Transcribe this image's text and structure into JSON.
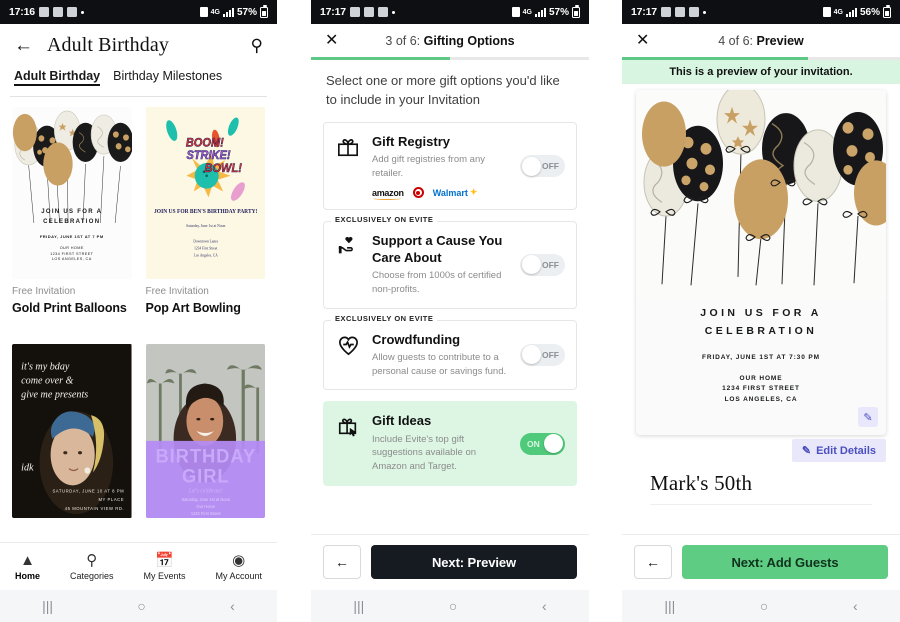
{
  "screen1": {
    "status": {
      "time": "17:16",
      "battery": "57%",
      "network": "4G"
    },
    "header": {
      "title": "Adult Birthday",
      "back_icon": "arrow-left-icon",
      "search_icon": "search-icon"
    },
    "tabs": [
      {
        "label": "Adult Birthday",
        "active": true
      },
      {
        "label": "Birthday Milestones",
        "active": false
      }
    ],
    "cards": [
      {
        "badge": "Free Invitation",
        "name": "Gold Print Balloons",
        "art": "balloons",
        "invite_heading": "JOIN US FOR A\nCELEBRATION",
        "invite_date": "FRIDAY, JUNE 1ST AT 7 PM",
        "invite_address": "OUR HOME\n1234 FIRST STREET\nLOS ANGELES, CA"
      },
      {
        "badge": "Free Invitation",
        "name": "Pop Art Bowling",
        "art": "bowling",
        "word1": "BOOM!",
        "word2": "STRIKE!",
        "word3": "BOWL!",
        "invite_heading": "JOIN US FOR BEN'S BIRTHDAY PARTY!",
        "invite_date": "Saturday, June 1st at Noon",
        "invite_address": "Downtown Lanes\n1234 First Street\nLos Angeles, CA"
      },
      {
        "art": "bday-portrait",
        "line1": "it's my bday",
        "line2": "come over &",
        "line3": "give me presents",
        "line4": "idk",
        "foot1": "SATURDAY, JUNE 10 AT 8 PM",
        "foot2": "MY PLACE",
        "foot3": "45 MOUNTAIN VIEW RD."
      },
      {
        "art": "birthday-girl",
        "title1": "BIRTHDAY",
        "title2": "GIRL",
        "sub": "Let's celebrate!",
        "foot1": "Saturday, June 1st at Noon",
        "foot2": "Our Home",
        "foot3": "1234 First Street"
      }
    ],
    "bottom_nav": [
      {
        "label": "Home",
        "icon": "home-icon",
        "active": true
      },
      {
        "label": "Categories",
        "icon": "search-icon",
        "active": false
      },
      {
        "label": "My Events",
        "icon": "calendar-icon",
        "active": false
      },
      {
        "label": "My Account",
        "icon": "account-circle-icon",
        "active": false
      }
    ]
  },
  "screen2": {
    "status": {
      "time": "17:17",
      "battery": "57%",
      "network": "4G"
    },
    "header": {
      "close_icon": "close-icon",
      "step": "3 of 6: ",
      "title": "Gifting Options"
    },
    "progress_percent": 50,
    "subtitle": "Select one or more gift options you'd like to include in your Invitation",
    "options": [
      {
        "icon": "gift-icon",
        "title": "Gift Registry",
        "desc": "Add gift registries from any retailer.",
        "toggle": "OFF",
        "toggle_on": false,
        "tag": "",
        "retailers": [
          "amazon",
          "Target",
          "Walmart"
        ]
      },
      {
        "icon": "hand-heart-icon",
        "title": "Support a Cause You Care About",
        "desc": "Choose from 1000s of certified non-profits.",
        "toggle": "OFF",
        "toggle_on": false,
        "tag": "EXCLUSIVELY ON EVITE"
      },
      {
        "icon": "heart-icon",
        "title": "Crowdfunding",
        "desc": "Allow guests to contribute to a personal cause or savings fund.",
        "toggle": "OFF",
        "toggle_on": false,
        "tag": "EXCLUSIVELY ON EVITE"
      },
      {
        "icon": "gift-tap-icon",
        "title": "Gift Ideas",
        "desc": "Include Evite's top gift suggestions available on Amazon and Target.",
        "toggle": "ON",
        "toggle_on": true,
        "tag": ""
      }
    ],
    "footer": {
      "back_icon": "arrow-left-icon",
      "next_label": "Next: Preview"
    }
  },
  "screen3": {
    "status": {
      "time": "17:17",
      "battery": "56%",
      "network": "4G"
    },
    "header": {
      "close_icon": "close-icon",
      "step": "4 of 6: ",
      "title": "Preview"
    },
    "progress_percent": 67,
    "banner": "This is a preview of your invitation.",
    "invitation": {
      "heading_line1": "JOIN US FOR A",
      "heading_line2": "CELEBRATION",
      "date": "FRIDAY, JUNE 1ST AT 7:30 PM",
      "address_line1": "OUR HOME",
      "address_line2": "1234 FIRST STREET",
      "address_line3": "LOS ANGELES, CA",
      "pencil_icon": "pencil-icon"
    },
    "edit_details": {
      "label": "Edit Details",
      "icon": "pencil-icon"
    },
    "event_name": "Mark's 50th",
    "footer": {
      "back_icon": "arrow-left-icon",
      "next_label": "Next: Add Guests"
    }
  },
  "system_nav": {
    "recents": "|||",
    "home": "○",
    "back": "‹"
  },
  "colors": {
    "accent_green": "#5fc887",
    "banner_green": "#d7f5e0",
    "toggle_on": "#4fc97a",
    "dark_button": "#161b22",
    "edit_purple": "#4b4fbf"
  }
}
